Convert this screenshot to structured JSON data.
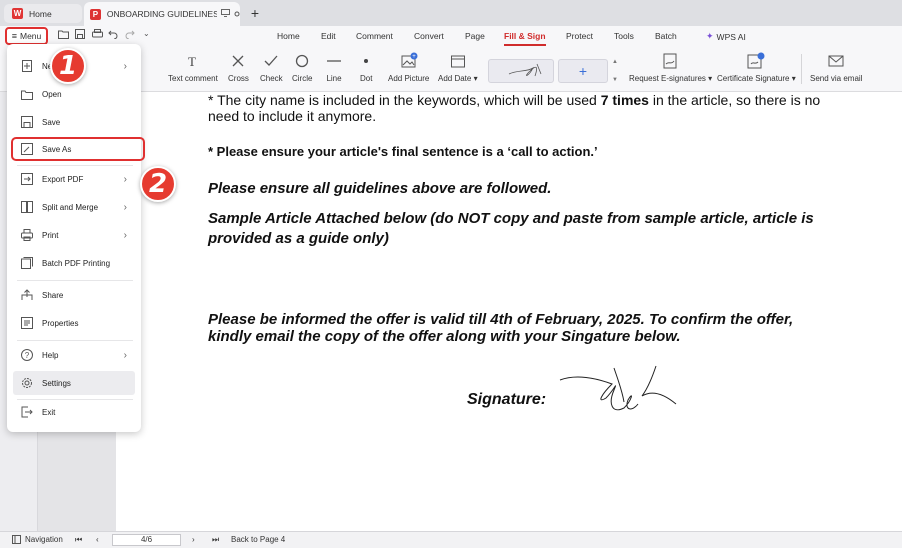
{
  "tabs": {
    "home_label": "Home",
    "doc_label": "ONBOARDING GUIDELINES PD",
    "new_tab_symbol": "+"
  },
  "menu": {
    "label": "Menu",
    "nav_tabs": [
      "Home",
      "Edit",
      "Comment",
      "Convert",
      "Page",
      "Fill & Sign",
      "Protect",
      "Tools",
      "Batch",
      "WPS AI"
    ],
    "active_tab": "Fill & Sign"
  },
  "ribbon": {
    "text_comment": "Text comment",
    "cross": "Cross",
    "check": "Check",
    "circle": "Circle",
    "line": "Line",
    "dot": "Dot",
    "add_picture": "Add Picture",
    "add_date": "Add Date",
    "add_signature_symbol": "+",
    "request_esign": "Request E-signatures",
    "certificate_signature": "Certificate Signature",
    "send_via_email": "Send via email"
  },
  "dropdown": {
    "items": [
      {
        "label": "New",
        "icon": "plus-doc-icon",
        "arrow": true
      },
      {
        "label": "Open",
        "icon": "folder-icon",
        "arrow": false
      },
      {
        "label": "Save",
        "icon": "save-icon",
        "arrow": false
      },
      {
        "label": "Save As",
        "icon": "save-as-icon",
        "arrow": false
      },
      {
        "label": "Export PDF",
        "icon": "export-icon",
        "arrow": true
      },
      {
        "label": "Split and Merge",
        "icon": "split-icon",
        "arrow": true
      },
      {
        "label": "Print",
        "icon": "print-icon",
        "arrow": true
      },
      {
        "label": "Batch PDF Printing",
        "icon": "batch-print-icon",
        "arrow": false
      },
      {
        "label": "Share",
        "icon": "share-icon",
        "arrow": false
      },
      {
        "label": "Properties",
        "icon": "properties-icon",
        "arrow": false
      },
      {
        "label": "Help",
        "icon": "help-icon",
        "arrow": true
      },
      {
        "label": "Settings",
        "icon": "gear-icon",
        "arrow": false
      },
      {
        "label": "Exit",
        "icon": "exit-icon",
        "arrow": false
      }
    ]
  },
  "badges": {
    "step1": "1",
    "step2": "2"
  },
  "document": {
    "line1_prefix": "* The city name is included in the keywords, which will be used ",
    "line1_bold": "7 times",
    "line1_suffix": " in the article, so there is no",
    "line2": "need to include it anymore.",
    "line3": "* Please ensure your article's final sentence is a ‘call to action.’",
    "line4": "Please ensure all guidelines above are followed.",
    "line5a": "Sample Article Attached below (do NOT copy and paste from sample article, article is",
    "line5b": "provided as a guide only)",
    "line6a": "Please be informed the offer is valid till 4th of February, 2025. To confirm the offer,",
    "line6b": "kindly email the copy of the offer along with your Singature below.",
    "signature_label": "Signature:"
  },
  "statusbar": {
    "navigation": "Navigation",
    "page_indicator": "4/6",
    "back_to_page": "Back to Page 4"
  },
  "colors": {
    "accent": "#d02c2c",
    "highlight_red": "#e03030",
    "badge_red": "#e63b30",
    "link_blue": "#3a6fd8"
  }
}
